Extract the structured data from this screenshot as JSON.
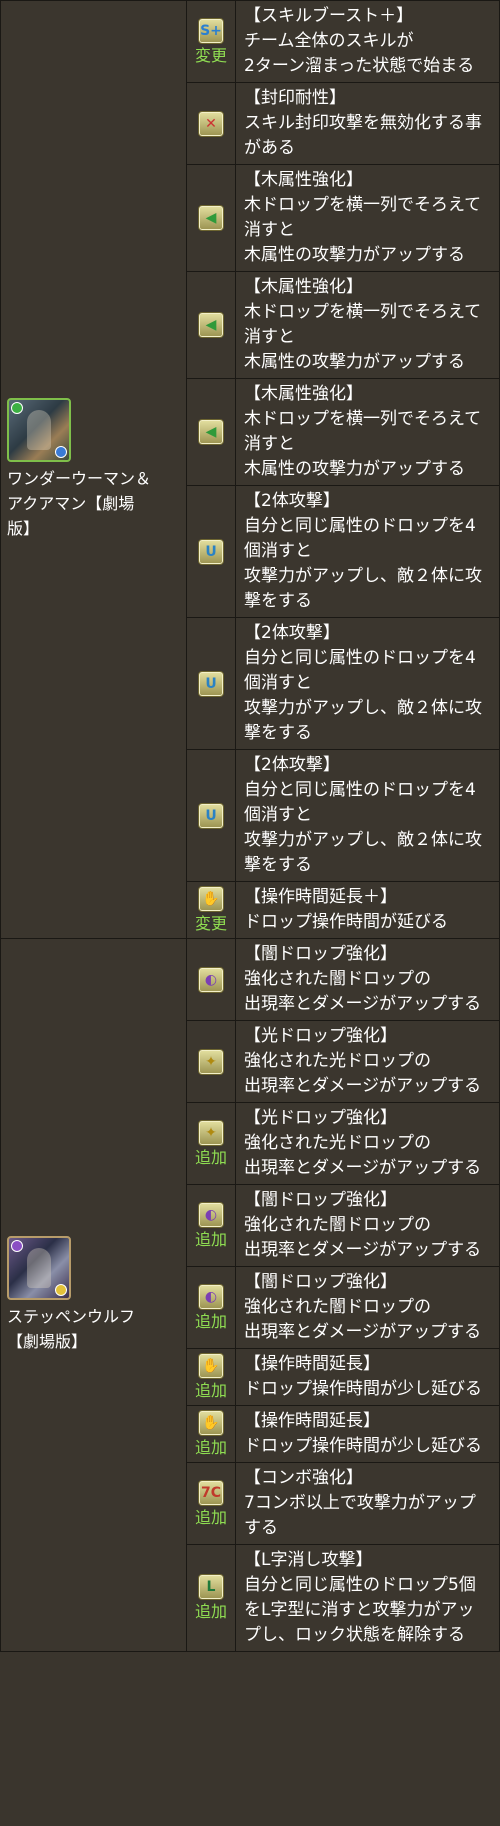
{
  "characters": [
    {
      "name": "ワンダーウーマン＆アクアマン【劇場版】",
      "name_lines": [
        "ワンダーウーマン＆",
        "アクアマン【劇場",
        "版】"
      ],
      "portrait_icon": "wonder-woman-aquaman-portrait",
      "attribute_colors": [
        "#3cb043",
        "#3a7bd5"
      ],
      "awakenings": [
        {
          "icon": "skill-boost-plus-icon",
          "glyph": "S+",
          "badge": "変更",
          "lines": [
            "【スキルブースト＋】",
            "チーム全体のスキルが",
            "2ターン溜まった状態で始まる"
          ]
        },
        {
          "icon": "seal-resist-icon",
          "glyph": "✕",
          "badge": "",
          "lines": [
            "【封印耐性】",
            "スキル封印攻撃を無効化する事",
            "がある"
          ]
        },
        {
          "icon": "wood-row-enhance-icon",
          "glyph": "◀",
          "badge": "",
          "lines": [
            "【木属性強化】",
            "木ドロップを横一列でそろえて",
            "消すと",
            "木属性の攻撃力がアップする"
          ]
        },
        {
          "icon": "wood-row-enhance-icon",
          "glyph": "◀",
          "badge": "",
          "lines": [
            "【木属性強化】",
            "木ドロップを横一列でそろえて",
            "消すと",
            "木属性の攻撃力がアップする"
          ]
        },
        {
          "icon": "wood-row-enhance-icon",
          "glyph": "◀",
          "badge": "",
          "lines": [
            "【木属性強化】",
            "木ドロップを横一列でそろえて",
            "消すと",
            "木属性の攻撃力がアップする"
          ]
        },
        {
          "icon": "two-pronged-attack-icon",
          "glyph": "U",
          "badge": "",
          "lines": [
            "【2体攻撃】",
            "自分と同じ属性のドロップを4",
            "個消すと",
            "攻撃力がアップし、敵２体に攻",
            "撃をする"
          ]
        },
        {
          "icon": "two-pronged-attack-icon",
          "glyph": "U",
          "badge": "",
          "lines": [
            "【2体攻撃】",
            "自分と同じ属性のドロップを4",
            "個消すと",
            "攻撃力がアップし、敵２体に攻",
            "撃をする"
          ]
        },
        {
          "icon": "two-pronged-attack-icon",
          "glyph": "U",
          "badge": "",
          "lines": [
            "【2体攻撃】",
            "自分と同じ属性のドロップを4",
            "個消すと",
            "攻撃力がアップし、敵２体に攻",
            "撃をする"
          ]
        },
        {
          "icon": "time-extend-plus-icon",
          "glyph": "✋+",
          "badge": "変更",
          "lines": [
            "【操作時間延長＋】",
            "ドロップ操作時間が延びる"
          ]
        }
      ]
    },
    {
      "name": "ステッペンウルフ【劇場版】",
      "name_lines": [
        "ステッペンウルフ",
        "【劇場版】"
      ],
      "portrait_icon": "steppenwolf-portrait",
      "attribute_colors": [
        "#8a4fc4",
        "#e2c13a"
      ],
      "awakenings": [
        {
          "icon": "dark-drop-enhance-icon",
          "glyph": "◐",
          "badge": "",
          "lines": [
            "【闇ドロップ強化】",
            "強化された闇ドロップの",
            "出現率とダメージがアップする"
          ]
        },
        {
          "icon": "light-drop-enhance-icon",
          "glyph": "✦",
          "badge": "",
          "lines": [
            "【光ドロップ強化】",
            "強化された光ドロップの",
            "出現率とダメージがアップする"
          ]
        },
        {
          "icon": "light-drop-enhance-icon",
          "glyph": "✦",
          "badge": "追加",
          "lines": [
            "【光ドロップ強化】",
            "強化された光ドロップの",
            "出現率とダメージがアップする"
          ]
        },
        {
          "icon": "dark-drop-enhance-icon",
          "glyph": "◐",
          "badge": "追加",
          "lines": [
            "【闇ドロップ強化】",
            "強化された闇ドロップの",
            "出現率とダメージがアップする"
          ]
        },
        {
          "icon": "dark-drop-enhance-icon",
          "glyph": "◐",
          "badge": "追加",
          "lines": [
            "【闇ドロップ強化】",
            "強化された闇ドロップの",
            "出現率とダメージがアップする"
          ]
        },
        {
          "icon": "time-extend-icon",
          "glyph": "✋",
          "badge": "追加",
          "lines": [
            "【操作時間延長】",
            "ドロップ操作時間が少し延びる"
          ]
        },
        {
          "icon": "time-extend-icon",
          "glyph": "✋",
          "badge": "追加",
          "lines": [
            "【操作時間延長】",
            "ドロップ操作時間が少し延びる"
          ]
        },
        {
          "icon": "combo-enhance-icon",
          "glyph": "7C",
          "badge": "追加",
          "lines": [
            "【コンボ強化】",
            "7コンボ以上で攻撃力がアップ",
            "する"
          ]
        },
        {
          "icon": "l-shape-attack-icon",
          "glyph": "L",
          "badge": "追加",
          "lines": [
            "【L字消し攻撃】",
            "自分と同じ属性のドロップ5個",
            "をL字型に消すと攻撃力がアッ",
            "プし、ロック状態を解除する"
          ]
        }
      ]
    }
  ]
}
